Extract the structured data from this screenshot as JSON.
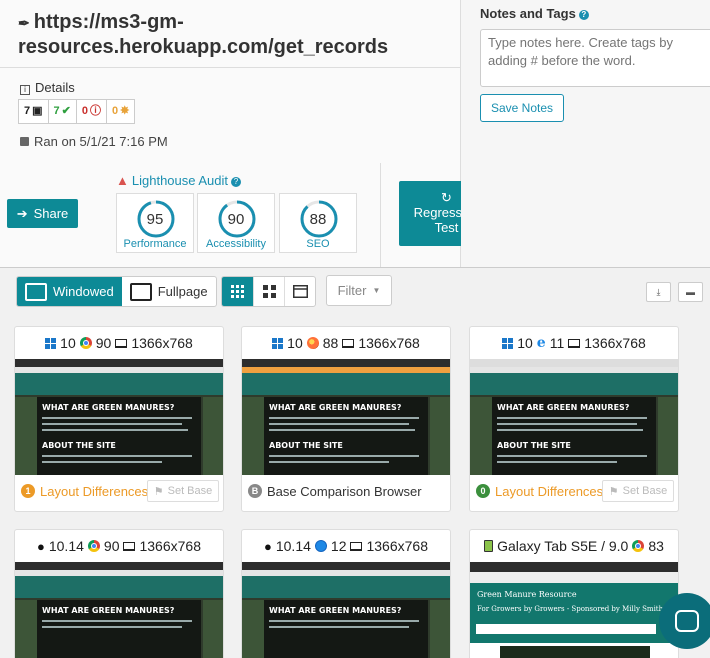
{
  "header": {
    "url_title": "https://ms3-gm-resources.herokuapp.com/get_records",
    "details_label": "Details",
    "badges": [
      {
        "count": "7",
        "kind": "screenshots",
        "color": "#222222"
      },
      {
        "count": "7",
        "kind": "passed",
        "color": "#2e9f3e"
      },
      {
        "count": "0",
        "kind": "errors",
        "color": "#c9302c"
      },
      {
        "count": "0",
        "kind": "pending",
        "color": "#e8a33a"
      }
    ],
    "ran_on": "Ran on 5/1/21 7:16 PM",
    "share_label": "Share",
    "regression_label": "Regression Test"
  },
  "lighthouse": {
    "label": "Lighthouse Audit",
    "scores": [
      {
        "value": "95",
        "label": "Performance",
        "fraction": 0.95
      },
      {
        "value": "90",
        "label": "Accessibility",
        "fraction": 0.9
      },
      {
        "value": "88",
        "label": "SEO",
        "fraction": 0.88
      }
    ]
  },
  "notes": {
    "title": "Notes and Tags",
    "placeholder": "Type notes here. Create tags by adding # before the word.",
    "save_label": "Save Notes"
  },
  "toolbar": {
    "windowed_label": "Windowed",
    "fullpage_label": "Fullpage",
    "filter_label": "Filter"
  },
  "cards": [
    {
      "os_icon": "windows-icon",
      "os_version": "10",
      "browser_icon": "chrome-icon",
      "browser_version": "90",
      "resolution": "1366x768",
      "status_count": "1",
      "status_text": "Layout Differences",
      "status_color": "#ec9a27",
      "set_base": "Set Base"
    },
    {
      "os_icon": "windows-icon",
      "os_version": "10",
      "browser_icon": "firefox-icon",
      "browser_version": "88",
      "resolution": "1366x768",
      "status_count": "B",
      "status_text": "Base Comparison Browser",
      "status_color": "#888888",
      "set_base": ""
    },
    {
      "os_icon": "windows-icon",
      "os_version": "10",
      "browser_icon": "ie-icon",
      "browser_version": "11",
      "resolution": "1366x768",
      "status_count": "0",
      "status_text": "Layout Differences",
      "status_color": "#3b8f3d",
      "set_base": "Set Base"
    },
    {
      "os_icon": "apple-icon",
      "os_version": "10.14",
      "browser_icon": "chrome-icon",
      "browser_version": "90",
      "resolution": "1366x768"
    },
    {
      "os_icon": "apple-icon",
      "os_version": "10.14",
      "browser_icon": "safari-icon",
      "browser_version": "12",
      "resolution": "1366x768"
    },
    {
      "os_icon": "tablet-icon",
      "device": "Galaxy Tab S5E / 9.0",
      "browser_icon": "chrome-icon",
      "browser_version": "83"
    }
  ],
  "screenshot_text": {
    "site_name": "Green Manure Resource",
    "hero_heading": "WHAT ARE GREEN MANURES?",
    "about_heading": "ABOUT THE SITE",
    "tablet_subtitle": "For Growers by Growers - Sponsored by Milly Smith"
  }
}
